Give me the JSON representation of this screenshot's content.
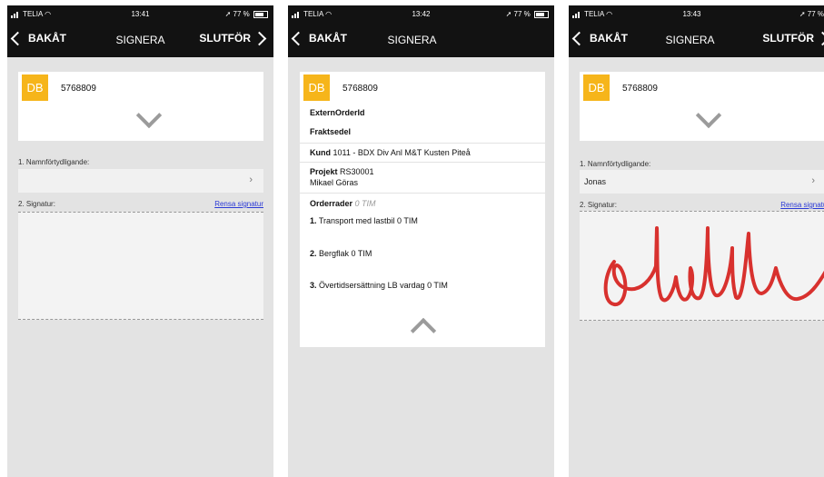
{
  "screens": [
    {
      "status": {
        "carrier": "TELIA",
        "time": "13:41",
        "battery": "77 %"
      },
      "nav": {
        "back": "BAKÅT",
        "title": "SIGNERA",
        "finish": "SLUTFÖR"
      },
      "order": {
        "badge": "DB",
        "number": "5768809"
      },
      "name_label": "1. Namnförtydligande:",
      "name_value": "",
      "signature_label": "2. Signatur:",
      "clear_label": "Rensa signatur"
    },
    {
      "status": {
        "carrier": "TELIA",
        "time": "13:42",
        "battery": "77 %"
      },
      "nav": {
        "back": "BAKÅT",
        "title": "SIGNERA"
      },
      "order": {
        "badge": "DB",
        "number": "5768809"
      },
      "details": {
        "external_order_id": "ExternOrderId",
        "waybill": "Fraktsedel",
        "customer_label": "Kund",
        "customer_value": "1011 - BDX Div Anl M&T Kusten Piteå",
        "project_label": "Projekt",
        "project_value": "RS30001",
        "contact": "Mikael Göras",
        "order_rows_label": "Orderrader",
        "order_rows_total": "0 TIM",
        "rows": [
          {
            "num": "1.",
            "text": "Transport med lastbil 0 TIM"
          },
          {
            "num": "2.",
            "text": "Bergflak 0 TIM"
          },
          {
            "num": "3.",
            "text": "Övertidsersättning LB vardag 0 TIM"
          }
        ]
      }
    },
    {
      "status": {
        "carrier": "TELIA",
        "time": "13:43",
        "battery": "77 %"
      },
      "nav": {
        "back": "BAKÅT",
        "title": "SIGNERA",
        "finish": "SLUTFÖR"
      },
      "order": {
        "badge": "DB",
        "number": "5768809"
      },
      "name_label": "1. Namnförtydligande:",
      "name_value": "Jonas",
      "signature_label": "2. Signatur:",
      "clear_label": "Rensa signatur",
      "signature_color": "#d8312e"
    }
  ],
  "colors": {
    "accent": "#f6b51a",
    "navbar": "#121212",
    "link": "#2a39d6"
  }
}
